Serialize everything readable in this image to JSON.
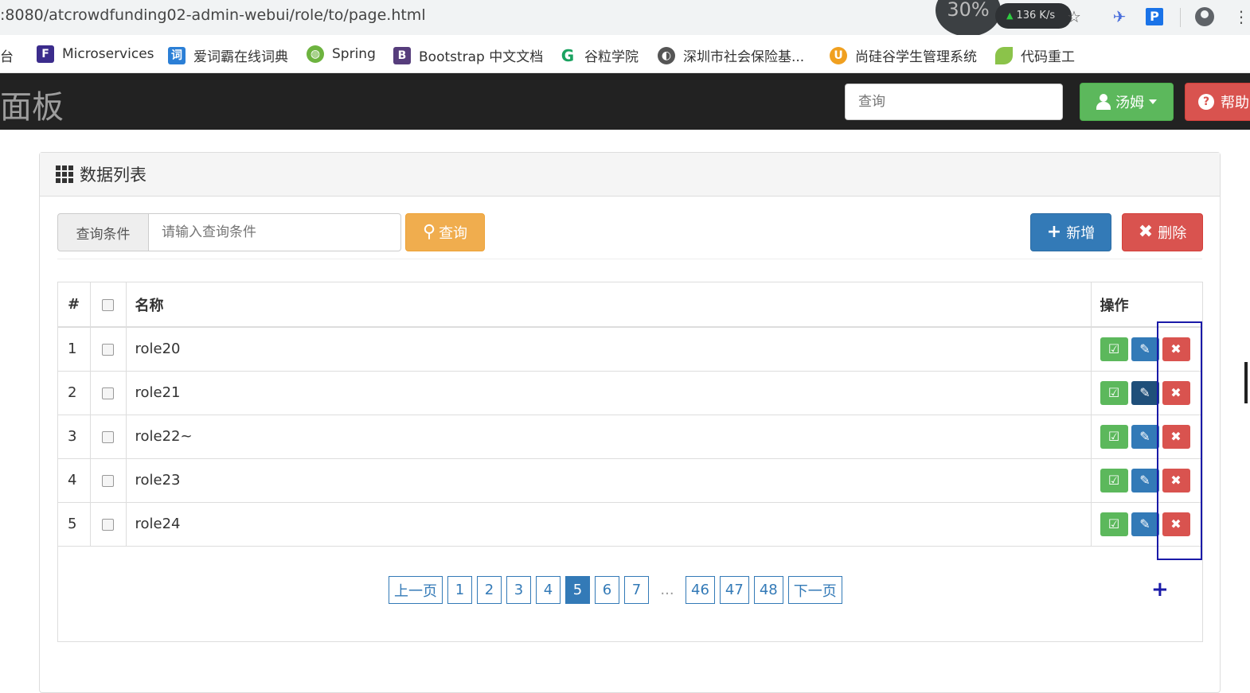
{
  "browser": {
    "url": ":8080/atcrowdfunding02-admin-webui/role/to/page.html",
    "speed_percent": "30%",
    "speed_rate": "136 K/s"
  },
  "bookmarks": [
    {
      "label": "台",
      "icon": "platform-icon"
    },
    {
      "label": "Microservices",
      "icon": "f-logo-icon"
    },
    {
      "label": "爱词霸在线词典",
      "icon": "dictionary-icon"
    },
    {
      "label": "Spring",
      "icon": "spring-leaf-icon"
    },
    {
      "label": "Bootstrap 中文文档",
      "icon": "bootstrap-b-icon"
    },
    {
      "label": "谷粒学院",
      "icon": "g-logo-icon"
    },
    {
      "label": "深圳市社会保险基...",
      "icon": "globe-icon"
    },
    {
      "label": "尚硅谷学生管理系统",
      "icon": "atguigu-icon"
    },
    {
      "label": "代码重工",
      "icon": "leaf-icon"
    }
  ],
  "navbar": {
    "brand": "面板",
    "search_placeholder": "查询",
    "user_label": "汤姆",
    "help_label": "帮助"
  },
  "panel": {
    "title": "数据列表",
    "condition_label": "查询条件",
    "condition_placeholder": "请输入查询条件",
    "query_button": "查询",
    "add_button": "新增",
    "delete_button": "删除"
  },
  "table": {
    "headers": {
      "num": "#",
      "name": "名称",
      "ops": "操作"
    },
    "rows": [
      {
        "num": "1",
        "name": "role20"
      },
      {
        "num": "2",
        "name": "role21"
      },
      {
        "num": "3",
        "name": "role22~"
      },
      {
        "num": "4",
        "name": "role23"
      },
      {
        "num": "5",
        "name": "role24"
      }
    ]
  },
  "pagination": {
    "prev": "上一页",
    "next": "下一页",
    "pages": [
      "1",
      "2",
      "3",
      "4",
      "5",
      "6",
      "7"
    ],
    "ellipsis": "...",
    "tail_pages": [
      "46",
      "47",
      "48"
    ],
    "current": "5"
  },
  "colors": {
    "navbar_bg": "#222222",
    "success": "#5cb85c",
    "primary": "#337ab7",
    "danger": "#d9534f",
    "warning": "#f0ad4e",
    "highlight": "#1a1aa8"
  }
}
